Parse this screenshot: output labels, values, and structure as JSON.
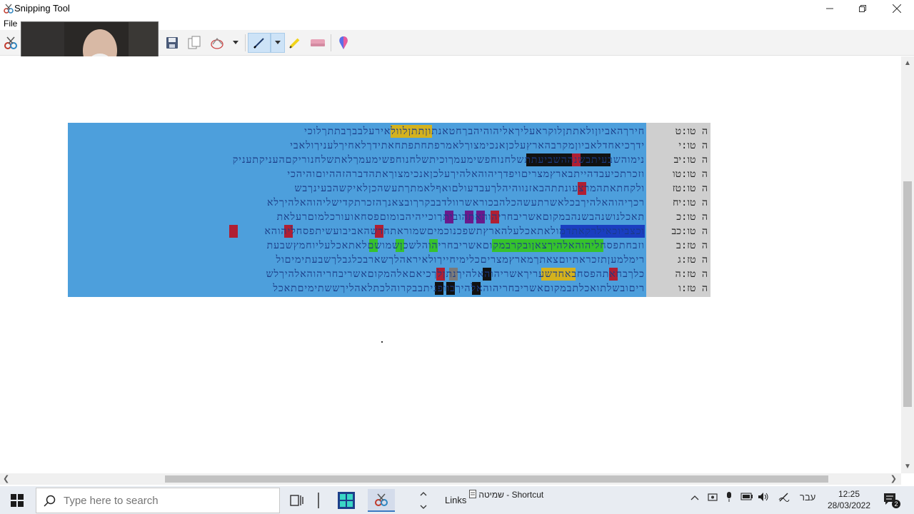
{
  "window": {
    "title": "Snipping Tool"
  },
  "menu": {
    "file": "File"
  },
  "toolbar": {
    "items": [
      "save-icon",
      "copy-icon",
      "send-snip-icon",
      "dropdown-icon",
      "pen-icon",
      "highlighter-icon",
      "eraser-icon",
      "paint-3d-icon"
    ]
  },
  "snip": {
    "rows": [
      {
        "ref": "ה טו:ט",
        "text": "חירךהאביוןולאתתןלוקראעליךאליהוהיהבךחטאנתוןתתןלוולאירעלבבךבתתךלוכי"
      },
      {
        "ref": "ה טו:י",
        "text": "ידךכיאחדלאביוןמקרבהארץעלכןאנכימצוךלאמרפתחתפתחאתידךלאחיךלעניךולאבי"
      },
      {
        "ref": "ה טו:יב",
        "text": "נימוהשבעיתבשנההשביעתתשלחנוחפשימעמךוכיתשלחנוחפשימעמךלאתשלחנוריקםהעניקתעניק"
      },
      {
        "ref": "ה טו:טו",
        "text": "וזכרתכיעבדהייתבארץמצריםויפדךיהוהאלהיךעלכןאנכימצוךאתהדברהזההיוםוהיהכי"
      },
      {
        "ref": "ה טו:טז",
        "text": "ולקחתאתהמרצעונתתהבאזנווהיהלךעבדעולםואףלאמתךתעשהכןלאיקשהבעינךבש"
      },
      {
        "ref": "ה טו:יח",
        "text": "רכךיהוהאלהיךבכלאשרתעשהכלהבכוראשרוולדבבקרךובצאנךהזכרתקדישליהוהאלהיךלא"
      },
      {
        "ref": "ה טו:כ",
        "text": "תאכלנושנהבשנהבמקוםאשריבחריהוהאתהוביתךוכייהיהבומוםפסחאועורכלמוםרעלאת"
      },
      {
        "ref": "ה טו:כב",
        "text": "וכצביוכאילרקאתדמולאתאכלעלהארץתשפכנוכמיםשמוראתחדשהאביבועשיתפסחליהוהא"
      },
      {
        "ref": "ה טז:ב",
        "text": "וזבחתפסחליהוהאלהיךצאןובקרבמקוםאשריבחריהוהלשכןשמושםלאתאכלעליוחמץשבעת"
      },
      {
        "ref": "ה טז:ג",
        "text": "רימלמעןתזכראתיוםצאתךמארץמצריםכלימיחייךולאיראהלךשארבכלגבלךשבעתימיםול"
      },
      {
        "ref": "ה טז:ה",
        "text": "כלךבחאתהפסחבאחדשעריךאשריהוהאלהיךנתןלךכיאםאלהמקוםאשריבחריהוהאלהיךלש"
      },
      {
        "ref": "ה טז:ו",
        "text": "ריםובשלתואכלתבמקוםאשריבחריהוהאלהיךבוופניתבבקרוהלכתלאהליךששתימיםתאכל"
      }
    ]
  },
  "taskbar": {
    "search_placeholder": "Type here to search",
    "links": "Links",
    "shortcut": "שמיטה - Shortcut",
    "lang": "עבר",
    "time": "12:25",
    "date": "28/03/2022",
    "notif_count": "2"
  }
}
